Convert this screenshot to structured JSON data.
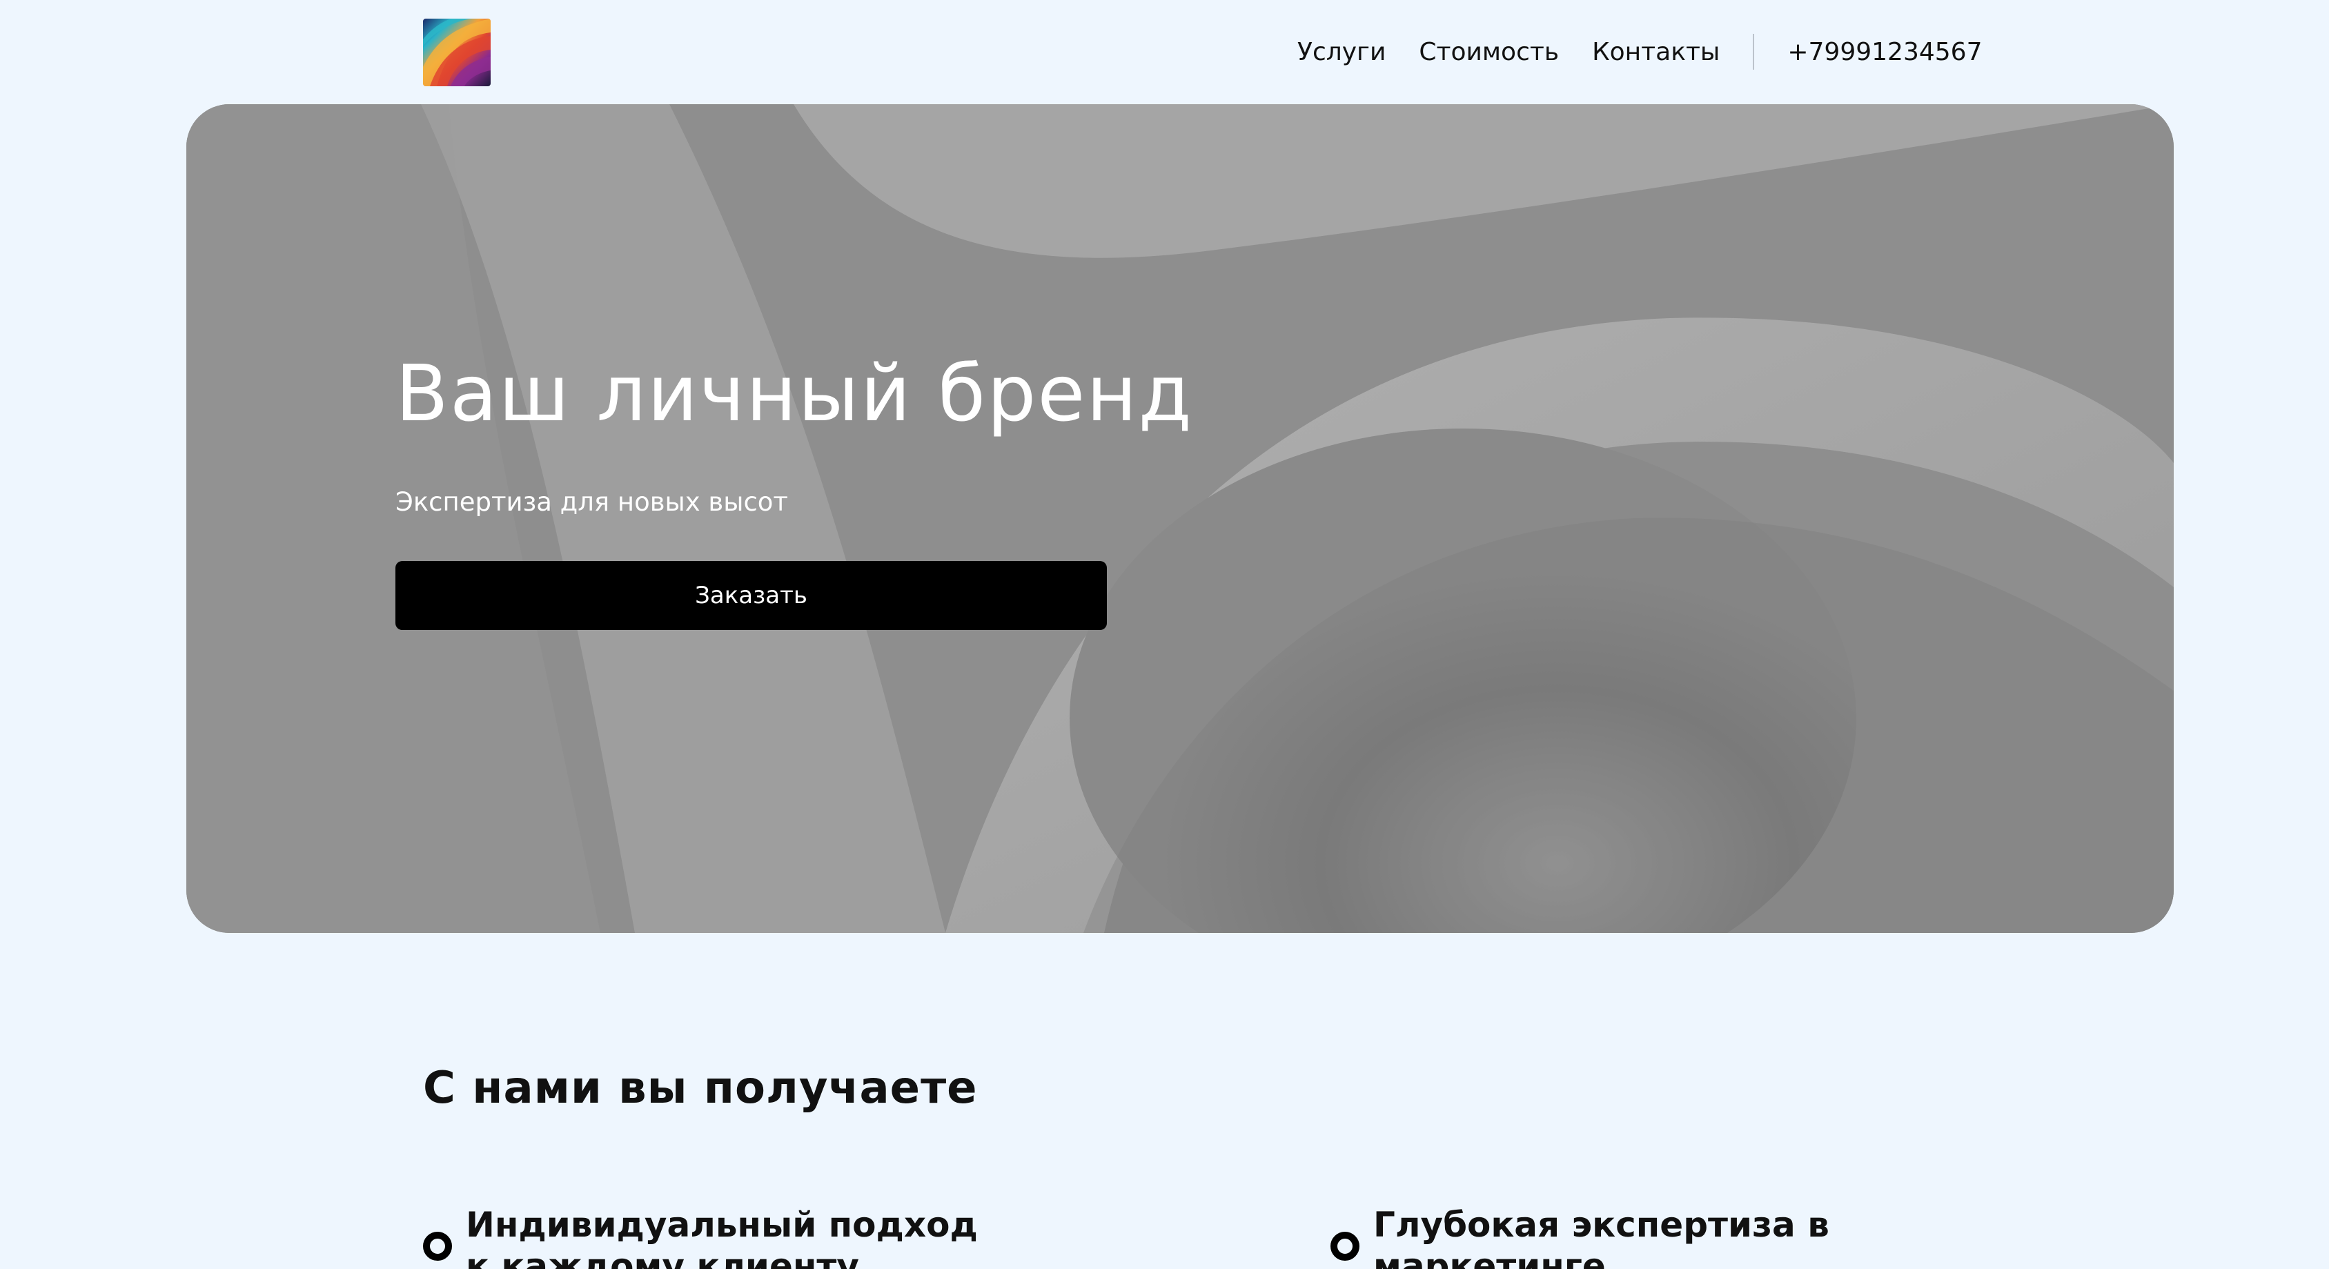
{
  "header": {
    "logo_alt": "logo",
    "nav": [
      {
        "label": "Услуги"
      },
      {
        "label": "Стоимость"
      },
      {
        "label": "Контакты"
      }
    ],
    "phone": "+79991234567"
  },
  "hero": {
    "title": "Ваш личный бренд",
    "subtitle": "Экспертиза для новых высот",
    "cta_label": "Заказать"
  },
  "benefits": {
    "title": "С нами вы получаете",
    "items": [
      {
        "text": "Индивидуальный подход к каждому клиенту"
      },
      {
        "text": "Глубокая экспертиза в маркетинге"
      }
    ]
  },
  "colors": {
    "background": "#eef6fe",
    "button": "#000000",
    "hero_text": "#ffffff"
  }
}
